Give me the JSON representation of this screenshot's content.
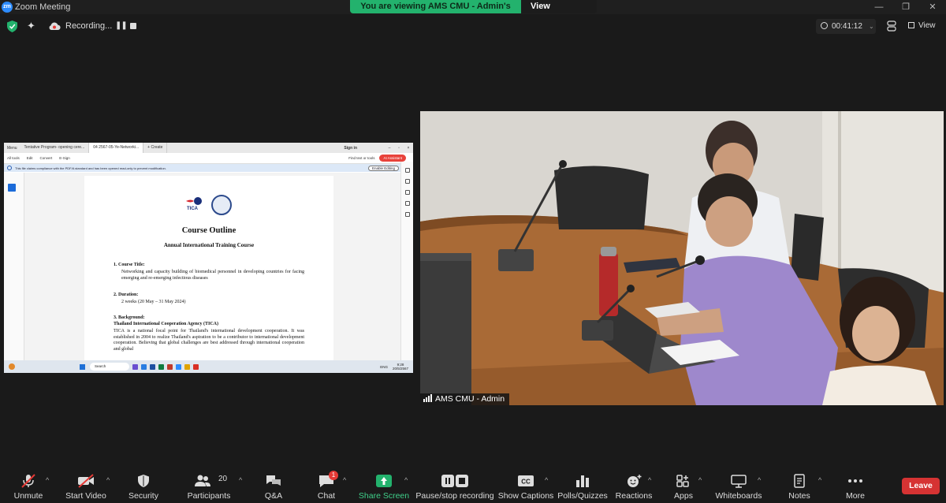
{
  "window": {
    "app_logo": "zm",
    "title": "Zoom Meeting",
    "controls": [
      "—",
      "❐",
      "✕"
    ]
  },
  "banner": {
    "viewing_text": "You are viewing AMS CMU - Admin's screen",
    "view_options": "View Options"
  },
  "status": {
    "recording_label": "Recording...",
    "timer": "00:41:12",
    "view_label": "View",
    "colors": {
      "shield": "#23b26d",
      "recording_cloud": "#dddddd"
    }
  },
  "shared_screen": {
    "browser": {
      "menu_label": "Menu",
      "tabs": [
        "Tentative Program- opening cere...",
        "04 2567-05-Ye-Networki..."
      ],
      "new_tab": "+ Create",
      "sign_in": "Sign in"
    },
    "pdf_toolbar": {
      "items": [
        "All tools",
        "Edit",
        "Convert",
        "E-Sign"
      ],
      "find": "Find text or tools",
      "ai_assistant": "AI Assistant"
    },
    "notice": {
      "text": "This file claims compliance with the PDF/A standard and has been opened read-only to prevent modification.",
      "button": "Enable Editing"
    },
    "document": {
      "logo_text": "TICA",
      "logo_subtext": "Thailand International Cooperation Agency",
      "title": "Course Outline",
      "subtitle": "Annual International Training Course",
      "sections": [
        {
          "heading": "1.   Course Title:",
          "text": "Networking and capacity building of biomedical personnel in developing countries for facing emerging and re-emerging infectious diseases"
        },
        {
          "heading": "2.   Duration:",
          "text": "2 weeks (20 May – 31 May 2024)"
        },
        {
          "heading": "3.   Background:",
          "subheading": "Thailand International Cooperation Agency (TICA)",
          "text": "TICA is a national focal point for Thailand's international development cooperation. It was established in 2004 to realize Thailand's aspiration to be a contributor to international development cooperation. Believing that global challenges are best addressed through international cooperation and global"
        }
      ]
    },
    "taskbar": {
      "search": "Search",
      "language": "ENG",
      "time": "9:28",
      "date": "20/5/2567"
    }
  },
  "video": {
    "participant_name": "AMS CMU - Admin"
  },
  "toolbar": {
    "buttons": [
      {
        "label": "Unmute",
        "icon": "microphone-muted-icon"
      },
      {
        "label": "Start Video",
        "icon": "video-off-icon"
      },
      {
        "label": "Security",
        "icon": "shield-icon"
      },
      {
        "label": "Participants",
        "icon": "participants-icon",
        "count": "20"
      },
      {
        "label": "Q&A",
        "icon": "qa-icon"
      },
      {
        "label": "Chat",
        "icon": "chat-icon",
        "badge": "1"
      },
      {
        "label": "Share Screen",
        "icon": "share-screen-icon"
      },
      {
        "label": "Pause/stop recording",
        "icon": "pause-recording-icon"
      },
      {
        "label": "Show Captions",
        "icon": "captions-icon",
        "icon_text": "CC"
      },
      {
        "label": "Polls/Quizzes",
        "icon": "polls-icon"
      },
      {
        "label": "Reactions",
        "icon": "reactions-icon"
      },
      {
        "label": "Apps",
        "icon": "apps-icon"
      },
      {
        "label": "Whiteboards",
        "icon": "whiteboard-icon"
      },
      {
        "label": "Notes",
        "icon": "notes-icon"
      },
      {
        "label": "More",
        "icon": "more-icon"
      }
    ],
    "leave": "Leave",
    "colors": {
      "share": "#23b26d",
      "leave": "#d63333",
      "badge": "#e53935"
    }
  }
}
